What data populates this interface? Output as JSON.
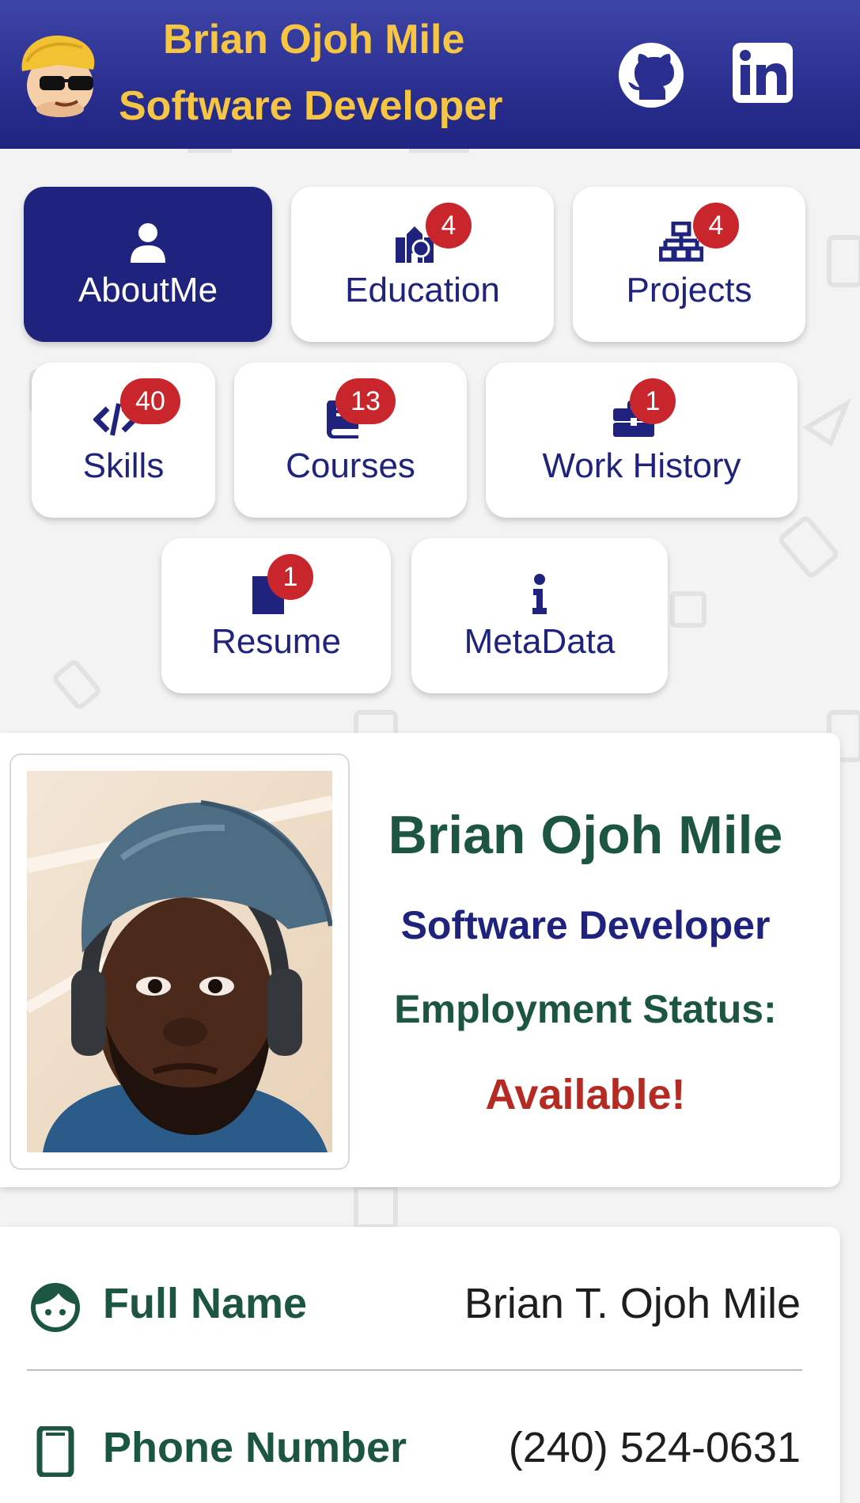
{
  "header": {
    "name": "Brian Ojoh Mile",
    "role": "Software Developer",
    "avatar_icon": "cartoon-avatar-icon",
    "links": [
      {
        "name": "github-icon"
      },
      {
        "name": "linkedin-icon"
      }
    ]
  },
  "nav": {
    "tiles": [
      {
        "label": "AboutMe",
        "icon": "user-icon",
        "badge": null,
        "active": true
      },
      {
        "label": "Education",
        "icon": "school-icon",
        "badge": "4",
        "active": false
      },
      {
        "label": "Projects",
        "icon": "sitemap-icon",
        "badge": "4",
        "active": false
      },
      {
        "label": "Skills",
        "icon": "code-icon",
        "badge": "40",
        "active": false
      },
      {
        "label": "Courses",
        "icon": "book-icon",
        "badge": "13",
        "active": false
      },
      {
        "label": "Work History",
        "icon": "briefcase-icon",
        "badge": "1",
        "active": false
      },
      {
        "label": "Resume",
        "icon": "document-icon",
        "badge": "1",
        "active": false
      },
      {
        "label": "MetaData",
        "icon": "info-icon",
        "badge": null,
        "active": false
      }
    ]
  },
  "profile": {
    "name": "Brian Ojoh Mile",
    "role": "Software Developer",
    "status_label": "Employment Status:",
    "status": "Available!"
  },
  "details": [
    {
      "label": "Full Name",
      "value": "Brian T. Ojoh Mile",
      "icon": "face-icon"
    },
    {
      "label": "Phone Number",
      "value": "(240) 524-0631",
      "icon": "phone-icon"
    }
  ],
  "colors": {
    "header_bg": "#2a2f8f",
    "header_text": "#f6c544",
    "primary": "#1f237d",
    "badge": "#c8262c",
    "green": "#1d5640",
    "status": "#b52a22"
  }
}
